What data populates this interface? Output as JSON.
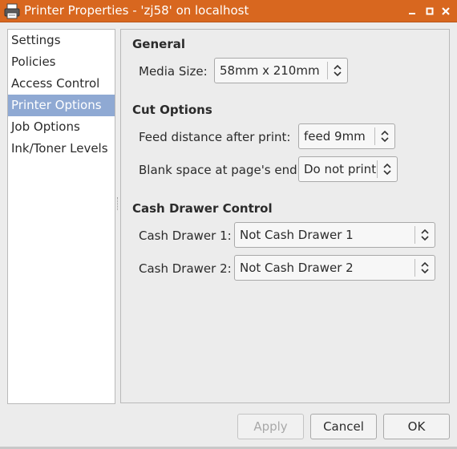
{
  "window": {
    "title": "Printer Properties - 'zj58' on localhost",
    "controls": [
      "minimize-icon",
      "maximize-icon",
      "close-icon"
    ]
  },
  "sidebar": {
    "items": [
      {
        "label": "Settings",
        "selected": false
      },
      {
        "label": "Policies",
        "selected": false
      },
      {
        "label": "Access Control",
        "selected": false
      },
      {
        "label": "Printer Options",
        "selected": true
      },
      {
        "label": "Job Options",
        "selected": false
      },
      {
        "label": "Ink/Toner Levels",
        "selected": false
      }
    ]
  },
  "general": {
    "heading": "General",
    "media_size_label": "Media Size:",
    "media_size_value": "58mm x 210mm"
  },
  "cut_options": {
    "heading": "Cut Options",
    "feed_label": "Feed distance after print:",
    "feed_value": "feed 9mm",
    "blank_label": "Blank space at page's end:",
    "blank_value": "Do not print"
  },
  "cash_drawer": {
    "heading": "Cash Drawer Control",
    "drawer1_label": "Cash Drawer 1:",
    "drawer1_value": "Not Cash Drawer 1",
    "drawer2_label": "Cash Drawer 2:",
    "drawer2_value": "Not Cash Drawer 2"
  },
  "buttons": {
    "apply": "Apply",
    "apply_enabled": false,
    "cancel": "Cancel",
    "ok": "OK"
  },
  "colors": {
    "titlebar": "#d8671f",
    "selection": "#8fa9d3"
  }
}
